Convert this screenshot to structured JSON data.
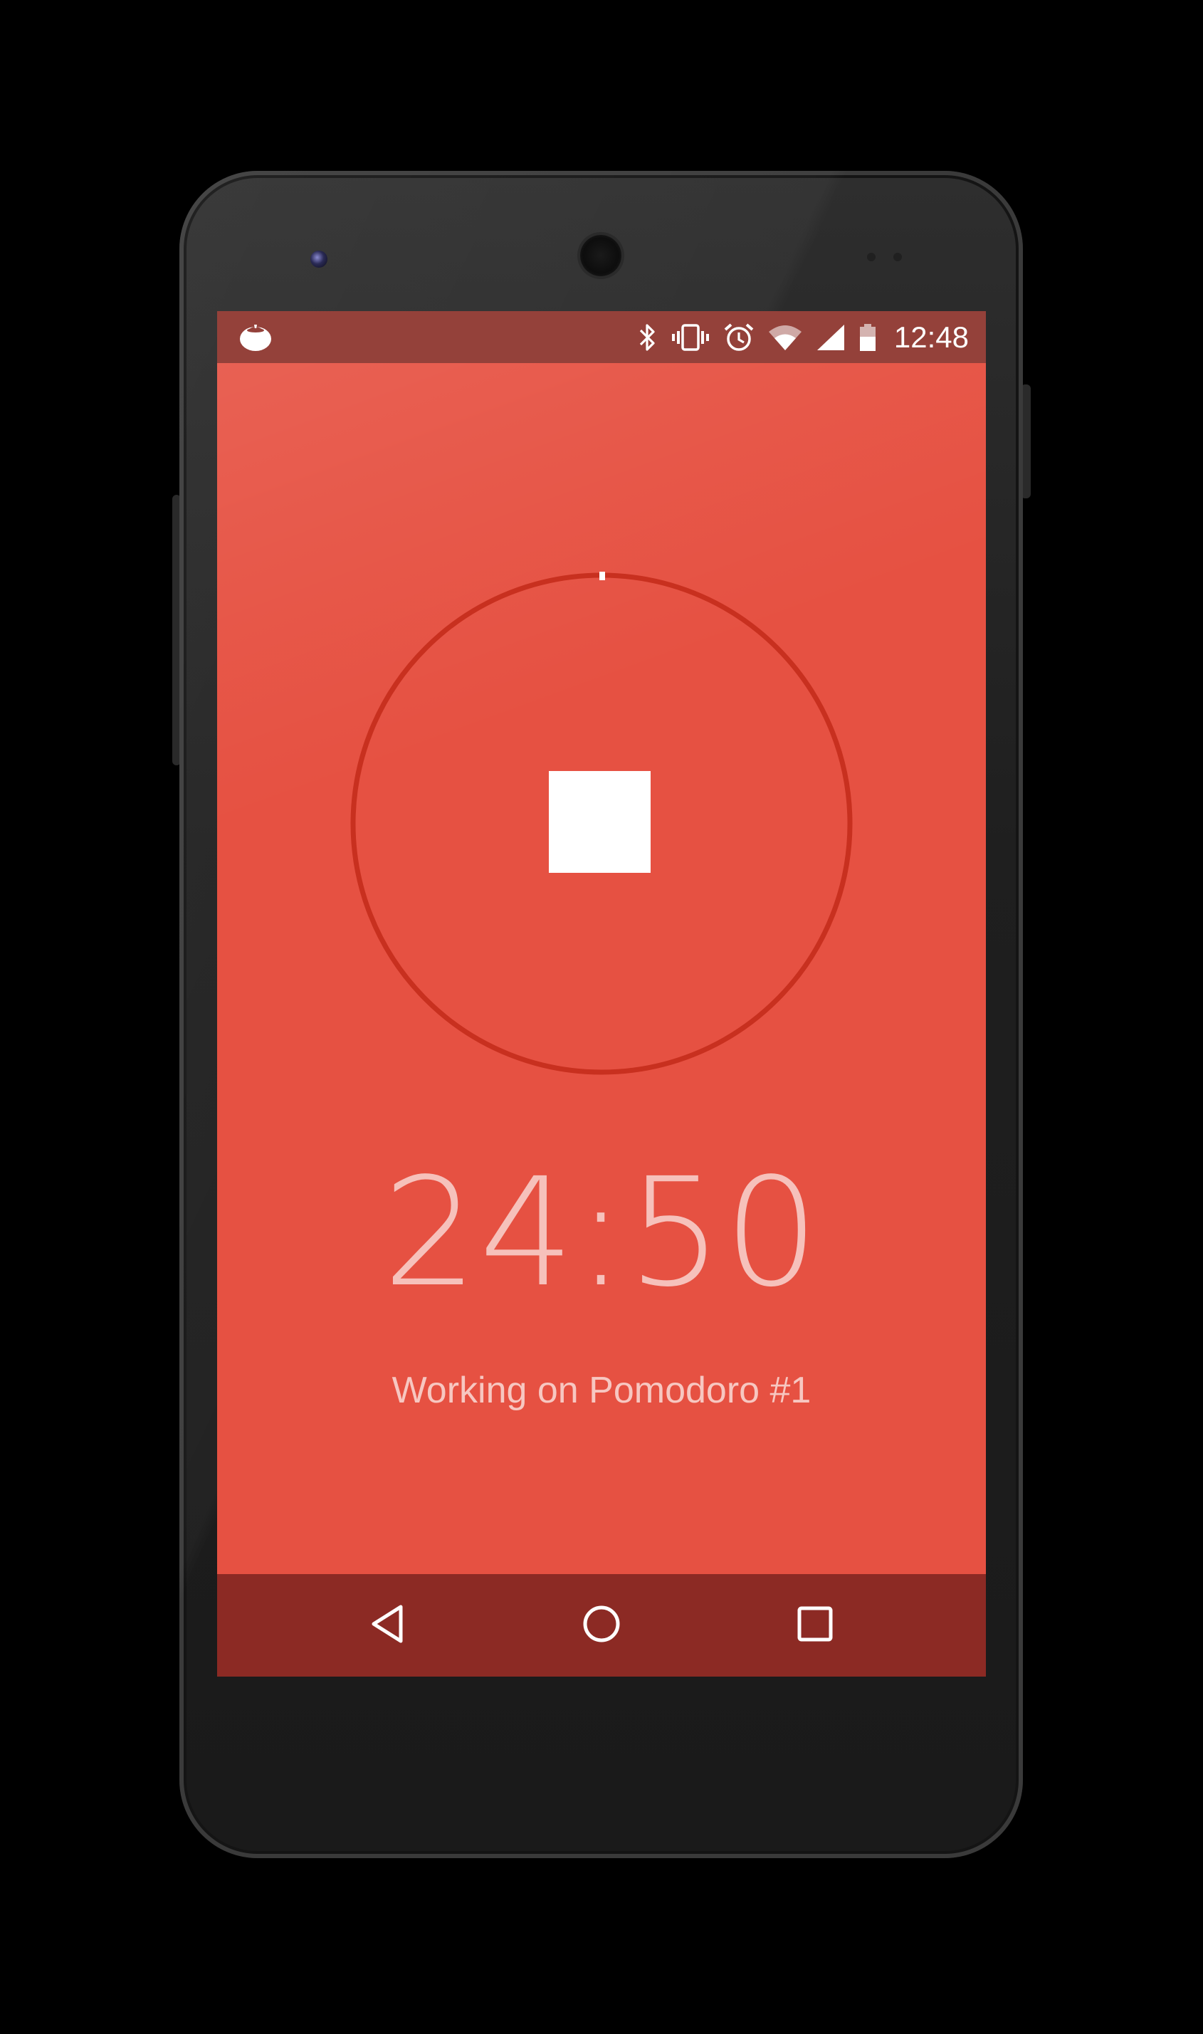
{
  "status_bar": {
    "time": "12:48",
    "app_icon": "tomato-icon",
    "indicators": [
      "bluetooth-icon",
      "vibrate-icon",
      "alarm-icon",
      "wifi-icon",
      "signal-icon",
      "battery-icon"
    ]
  },
  "timer": {
    "countdown": "24:50",
    "status_text": "Working on Pomodoro #1",
    "control": "stop-icon"
  },
  "nav_bar": {
    "buttons": [
      "back-icon",
      "home-icon",
      "recents-icon"
    ]
  },
  "colors": {
    "screen_background": "#e65142",
    "status_bar": "#94413a",
    "nav_bar": "#8c2a24",
    "ring": "#c8301f",
    "text": "#f6c1bb"
  }
}
